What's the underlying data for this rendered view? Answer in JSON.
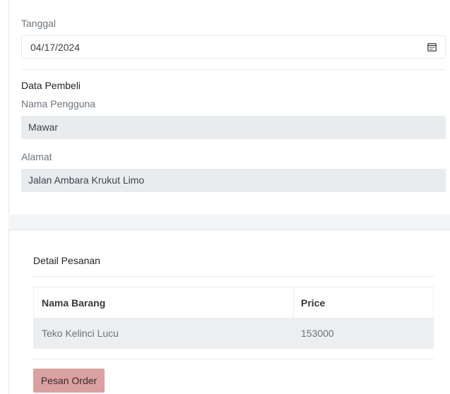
{
  "date": {
    "label": "Tanggal",
    "value": "04/17/2024",
    "icon": "calendar-icon"
  },
  "buyer": {
    "section_title": "Data Pembeli",
    "username_label": "Nama Pengguna",
    "username_value": "Mawar",
    "address_label": "Alamat",
    "address_value": "Jalan Ambara Krukut Limo"
  },
  "order": {
    "section_title": "Detail Pesanan",
    "table": {
      "headers": [
        "Nama Barang",
        "Price"
      ],
      "rows": [
        [
          "Teko Kelinci Lucu",
          "153000"
        ]
      ]
    },
    "submit_label": "Pesan Order"
  },
  "colors": {
    "button_bg": "#d9a1a1",
    "field_readonly_bg": "#e9ecef",
    "table_row_bg": "#eceef0"
  }
}
